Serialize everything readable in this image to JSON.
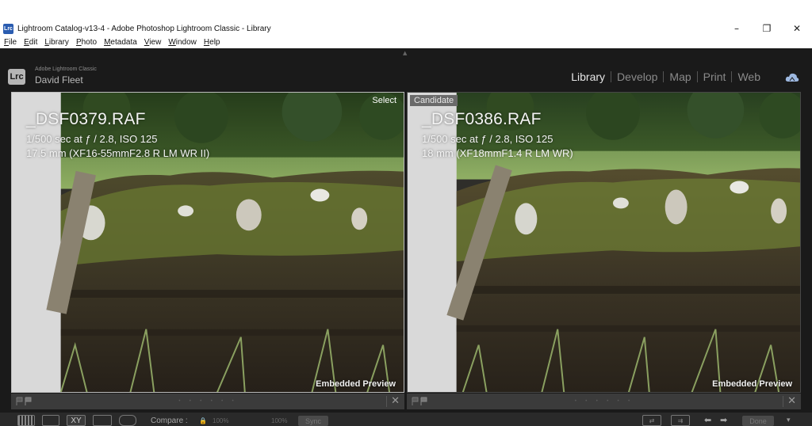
{
  "window": {
    "title": "Lightroom Catalog-v13-4 - Adobe Photoshop Lightroom Classic - Library",
    "icon_label": "Lrc",
    "controls": {
      "minimize": "–",
      "restore": "❐",
      "close": "✕"
    }
  },
  "menu": [
    "File",
    "Edit",
    "Library",
    "Photo",
    "Metadata",
    "View",
    "Window",
    "Help"
  ],
  "identity": {
    "badge": "Lrc",
    "product": "Adobe Lightroom Classic",
    "user": "David Fleet"
  },
  "modules": [
    {
      "label": "Library",
      "active": true
    },
    {
      "label": "Develop",
      "active": false
    },
    {
      "label": "Map",
      "active": false
    },
    {
      "label": "Print",
      "active": false
    },
    {
      "label": "Web",
      "active": false
    }
  ],
  "compare": {
    "select": {
      "label": "Select",
      "file": "_DSF0379.RAF",
      "exposure": "1/500 sec at ƒ / 2.8, ISO 125",
      "lens": "17.5 mm (XF16-55mmF2.8 R LM WR II)",
      "preview": "Embedded Preview"
    },
    "candidate": {
      "label": "Candidate",
      "file": "_DSF0386.RAF",
      "exposure": "1/500 sec at ƒ / 2.8, ISO 125",
      "lens": "18 mm (XF18mmF1.4 R LM WR)",
      "preview": "Embedded Preview"
    }
  },
  "footer": {
    "close": "✕",
    "dots": "• • • • • •"
  },
  "toolbar": {
    "compare_label": "Compare :",
    "zoom_left": "100%",
    "zoom_right": "100%",
    "sync": "Sync",
    "xy_label": "XY",
    "done": "Done"
  },
  "colors": {
    "accent_active": "#e6e6e6",
    "panel_bg": "#1a1a1a"
  }
}
